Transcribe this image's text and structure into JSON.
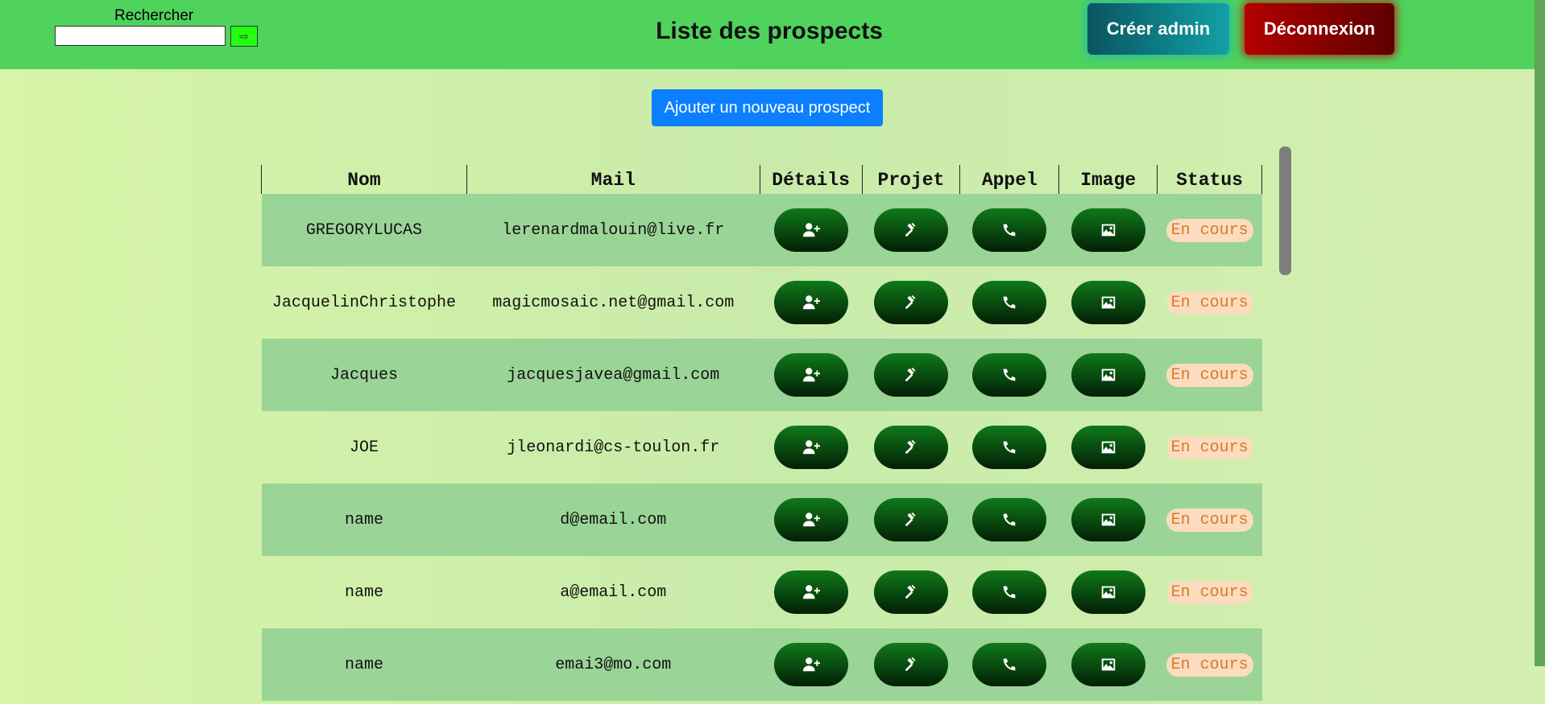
{
  "header": {
    "search_label": "Rechercher",
    "search_value": "",
    "search_button_glyph": "⇨",
    "title": "Liste des prospects",
    "admin_button": "Créer admin",
    "logout_button": "Déconnexion"
  },
  "add_button": "Ajouter un nouveau prospect",
  "table": {
    "columns": [
      "Nom",
      "Mail",
      "Détails",
      "Projet",
      "Appel",
      "Image",
      "Status"
    ],
    "rows": [
      {
        "nom": "GREGORYLUCAS",
        "mail": "lerenardmalouin@live.fr",
        "status": "En cours"
      },
      {
        "nom": "JacquelinChristophe",
        "mail": "magicmosaic.net@gmail.com",
        "status": "En cours"
      },
      {
        "nom": "Jacques",
        "mail": "jacquesjavea@gmail.com",
        "status": "En cours"
      },
      {
        "nom": "JOE",
        "mail": "jleonardi@cs-toulon.fr",
        "status": "En cours"
      },
      {
        "nom": "name",
        "mail": "d@email.com",
        "status": "En cours"
      },
      {
        "nom": "name",
        "mail": "a@email.com",
        "status": "En cours"
      },
      {
        "nom": "name",
        "mail": "emai3@mo.com",
        "status": "En cours"
      }
    ],
    "action_icons": [
      "user-plus-icon",
      "hammer-icon",
      "phone-icon",
      "image-icon"
    ]
  },
  "colors": {
    "header_bg": "#4fd35c",
    "add_button": "#0b7fff",
    "admin_button": "#12a0a6",
    "logout_button": "#b30000",
    "row_alt": "#9bd497",
    "status_bg": "#fbdcbf",
    "status_text": "#d77a2a"
  }
}
